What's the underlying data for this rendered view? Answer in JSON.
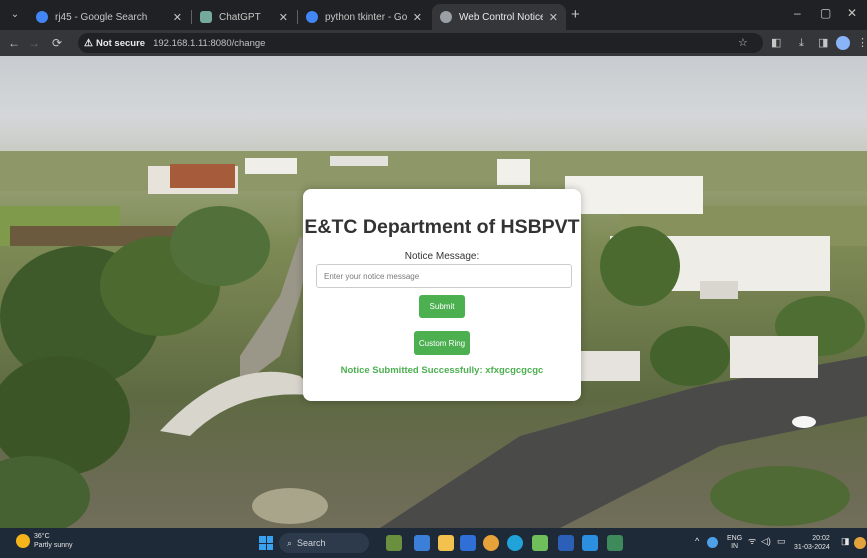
{
  "browser": {
    "tabs": [
      {
        "label": "rj45 - Google Search",
        "active": false,
        "favicon_color": "#4285f4"
      },
      {
        "label": "ChatGPT",
        "active": false,
        "favicon_color": "#74aa9c"
      },
      {
        "label": "python tkinter - Google Search",
        "active": false,
        "favicon_color": "#4285f4"
      },
      {
        "label": "Web Control Notice Board",
        "active": true,
        "favicon_color": "#9aa0a6"
      }
    ],
    "security_label": "Not secure",
    "url": "192.168.1.11:8080/change"
  },
  "page": {
    "title": "E&TC Department of HSBPVT",
    "notice_label": "Notice Message:",
    "input_placeholder": "Enter your notice message",
    "input_value": "",
    "submit_label": "Submit",
    "custom_ring_label": "Custom Ring",
    "status_message": "Notice Submitted Successfully: xfxgcgcgcgc",
    "accent_color": "#4caf50"
  },
  "taskbar": {
    "weather_temp": "36°C",
    "weather_desc": "Partly sunny",
    "search_placeholder": "Search",
    "lang_top": "ENG",
    "lang_bottom": "IN",
    "time": "20:02",
    "date": "31-03-2024"
  }
}
